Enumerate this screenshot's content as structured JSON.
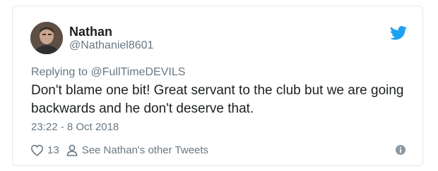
{
  "tweet": {
    "author_name": "Nathan",
    "author_handle": "@Nathaniel8601",
    "replying_prefix": "Replying to ",
    "replying_to": "@FullTimeDEVILS",
    "text": "Don't blame one bit! Great servant to the club but we are going backwards and he don't deserve that.",
    "timestamp": "23:22 - 8 Oct 2018",
    "like_count": "13",
    "other_tweets_label": "See Nathan's other Tweets"
  },
  "icons": {
    "brand": "twitter-bird-icon",
    "like": "heart-icon",
    "profile": "person-icon",
    "info": "info-icon"
  },
  "colors": {
    "twitter_blue": "#1da1f2",
    "text": "#1c2022",
    "muted": "#697882",
    "border": "#e1e8ed"
  }
}
